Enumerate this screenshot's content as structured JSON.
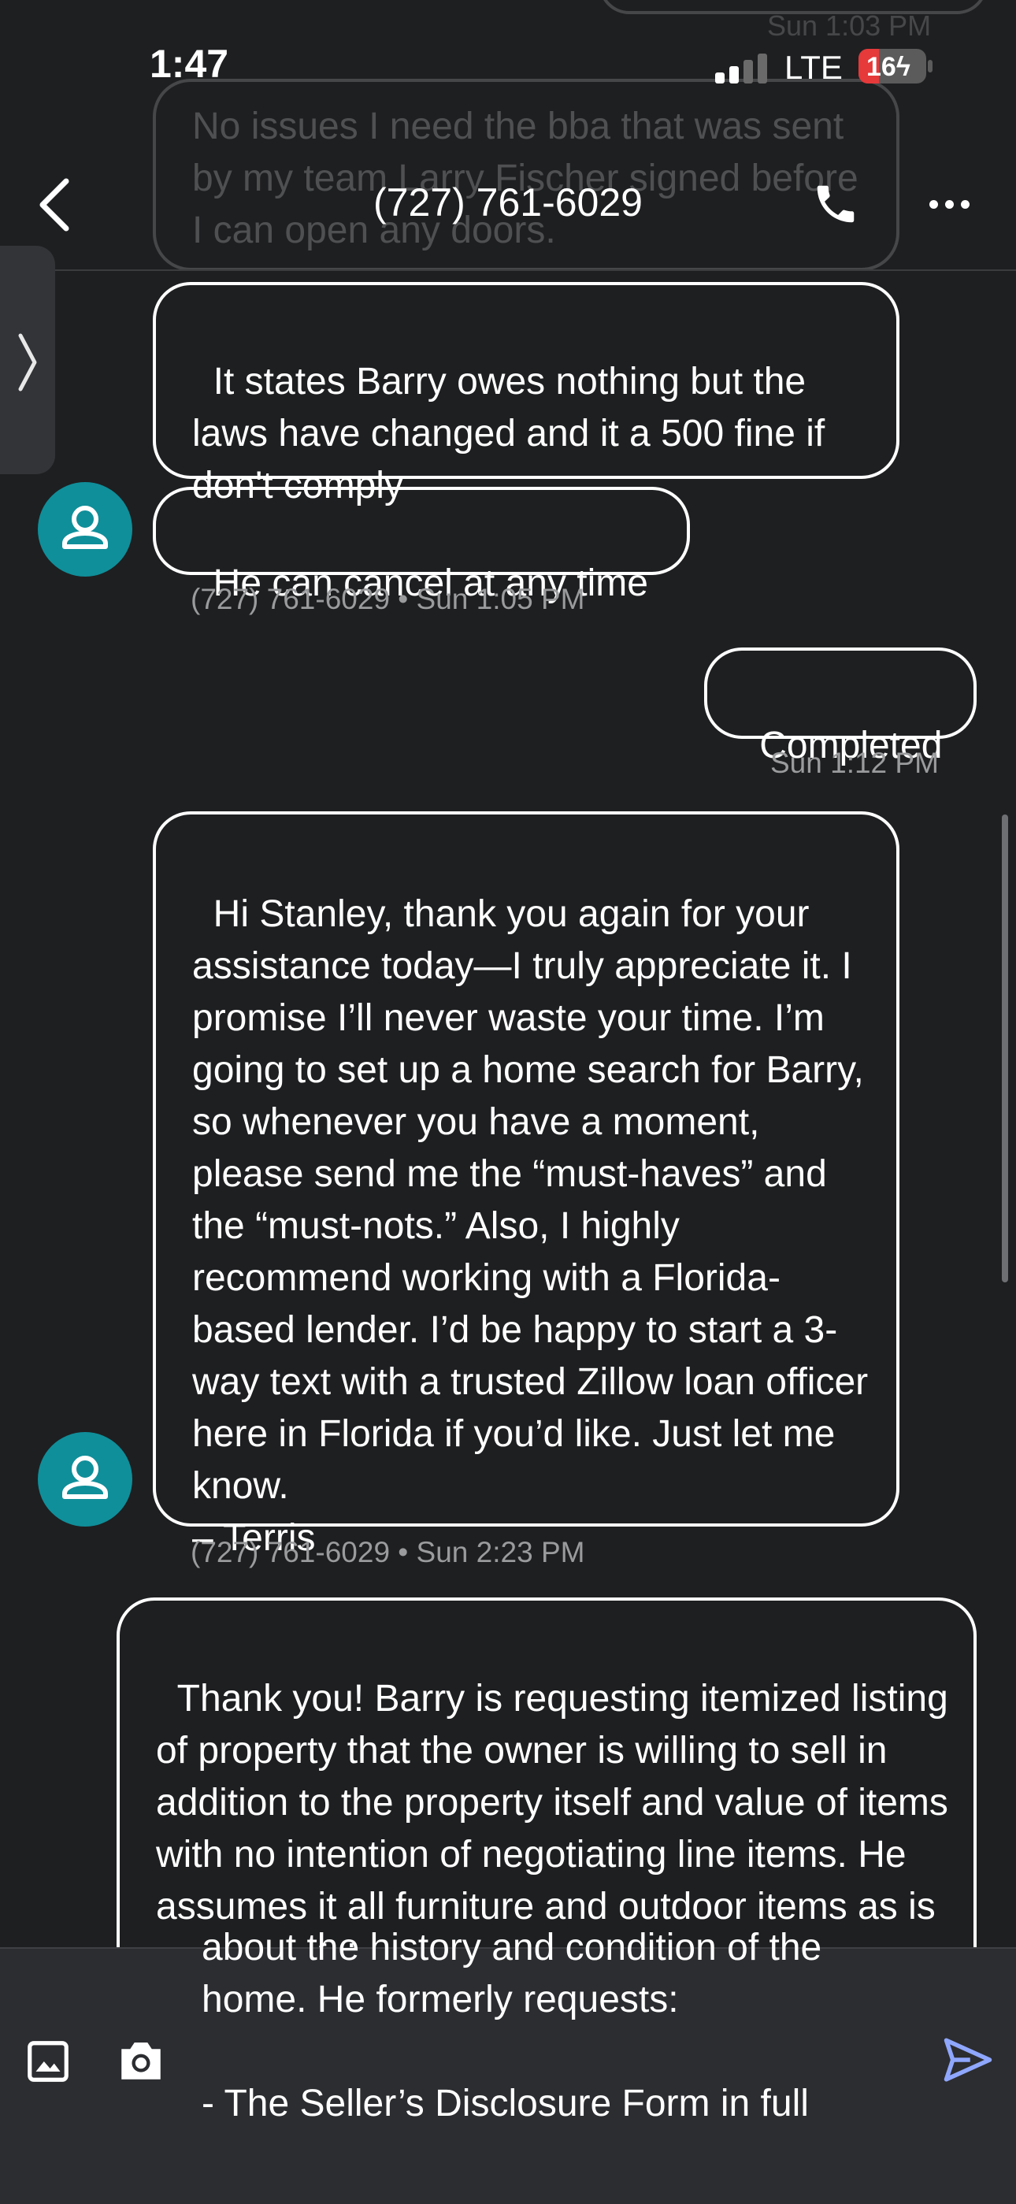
{
  "status_bar": {
    "time": "1:47",
    "network": "LTE",
    "battery": "16"
  },
  "header": {
    "title": "(727) 761-6029"
  },
  "faded": {
    "top_timestamp": "Sun 1:03 PM",
    "message": "No issues I need the bba that was sent by my team Larry Fischer signed before I can open any doors."
  },
  "messages": [
    {
      "text": "It states Barry owes nothing but the laws have changed and it a 500 fine if don't comply"
    },
    {
      "text": "He can cancel at any time",
      "meta": "(727) 761-6029 • Sun 1:05 PM"
    },
    {
      "text": "Completed",
      "meta": "Sun 1:12 PM"
    },
    {
      "text": "Hi Stanley, thank you again for your assistance today—I truly appreciate it. I promise I’ll never waste your time. I’m going to set up a home search for Barry, so whenever you have a moment, please send me the “must-haves” and the “must-nots.” Also, I highly recommend working with a Florida-based lender. I’d be happy to start a 3-way text with a trusted Zillow loan officer here in Florida if you’d like. Just let me know.\n– Terris",
      "meta": "(727) 761-6029 • Sun 2:23 PM"
    },
    {
      "text": "Thank you! Barry is requesting itemized listing of property that the owner is willing to sell in addition to the property itself and value of items with no intention of negotiating line items. He assumes it all furniture and outdoor items as is or none of the"
    }
  ],
  "compose": {
    "text": "about the history and condition of the home. He formerly requests:\n\n- The Seller’s Disclosure Form in full"
  },
  "icons": {
    "back": "chevron-left-icon",
    "phone": "phone-icon",
    "more": "more-horizontal-icon",
    "gallery": "image-icon",
    "camera": "camera-icon",
    "send": "send-icon",
    "avatar": "person-icon"
  },
  "colors": {
    "background": "#1e1f21",
    "avatar": "#0f8f9a",
    "send": "#8fa7ff",
    "battery_low": "#e5393a"
  }
}
